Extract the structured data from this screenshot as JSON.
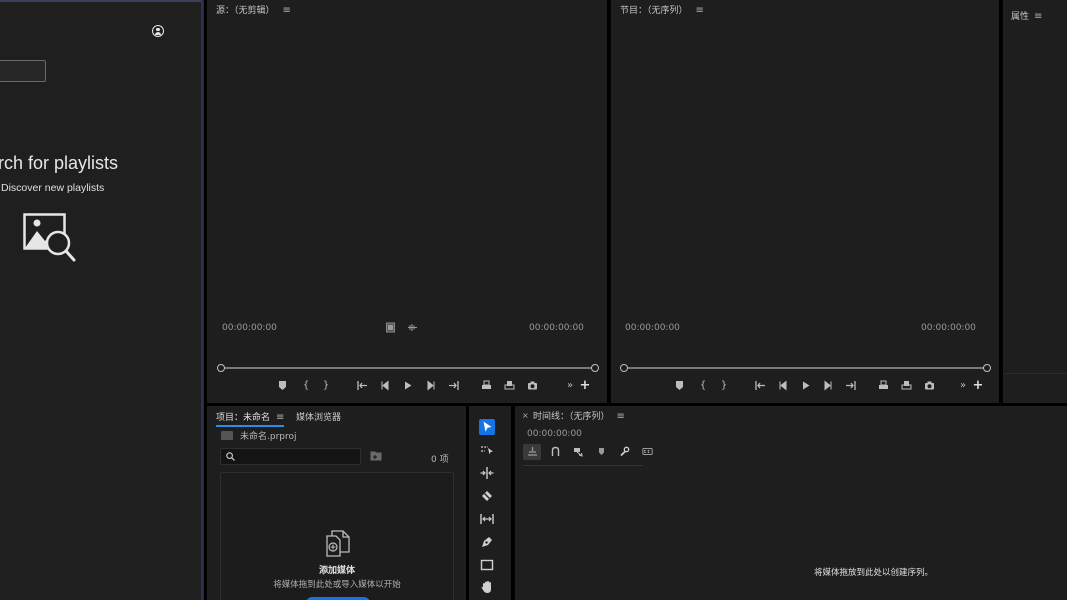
{
  "left_panel": {
    "playlists_title": "arch for playlists",
    "playlists_subtitle": "Discover new playlists"
  },
  "source_monitor": {
    "title": "源：（无剪辑）",
    "menu": "≡",
    "timecode_left": "00:00:00:00",
    "timecode_right": "00:00:00:00"
  },
  "program_monitor": {
    "title": "节目：（无序列）",
    "menu": "≡",
    "timecode_left": "00:00:00:00",
    "timecode_right": "00:00:00:00"
  },
  "properties_panel": {
    "title": "属性",
    "menu": "≡"
  },
  "project_panel": {
    "tab_project": "项目：未命名",
    "tab_menu": "≡",
    "tab_media_browser": "媒体浏览器",
    "file_name": "未命名.prproj",
    "item_count": "0 项",
    "add_media_title": "添加媒体",
    "add_media_sub": "将媒体拖到此处或导入媒体以开始"
  },
  "tools_panel": {
    "tools": [
      "selection-tool",
      "track-select-tool",
      "ripple-edit-tool",
      "razor-tool",
      "slip-tool",
      "pen-tool",
      "rectangle-tool",
      "hand-tool"
    ]
  },
  "timeline_panel": {
    "close": "×",
    "title": "时间线：（无序列）",
    "menu": "≡",
    "timecode": "00:00:00:00",
    "empty_message": "将媒体拖放到此处以创建序列。"
  },
  "colors": {
    "accent": "#1473e6",
    "panel_bg": "#1e1e1e",
    "frame_bg": "#000000"
  }
}
